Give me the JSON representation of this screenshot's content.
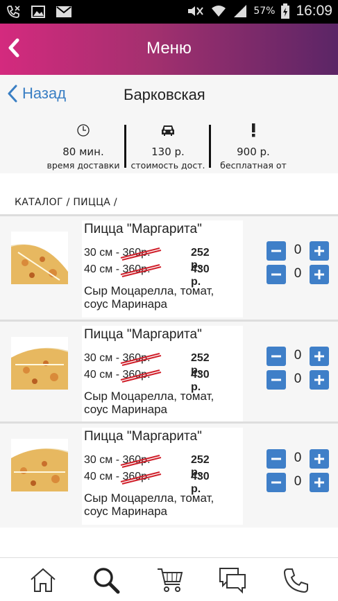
{
  "status_bar": {
    "battery": "57%",
    "time": "16:09"
  },
  "app_bar": {
    "title": "Меню"
  },
  "sub_nav": {
    "back_label": "Назад",
    "restaurant": "Барковская"
  },
  "info": [
    {
      "icon": "clock-icon",
      "value": "80 мин.",
      "label": "время доставки"
    },
    {
      "icon": "car-icon",
      "value": "130 р.",
      "label": "стоимость дост."
    },
    {
      "icon": "exclamation-icon",
      "value": "900 р.",
      "label": "бесплатная от"
    }
  ],
  "breadcrumb": "КАТАЛОГ / ПИЦЦА /",
  "items": [
    {
      "name": "Пицца \"Маргарита\"",
      "variants": [
        {
          "size": "30 см - ",
          "old_price": "360р.",
          "new_price": "252 р.",
          "qty": "0"
        },
        {
          "size": "40 см - ",
          "old_price": "360р.",
          "new_price": "430 р.",
          "qty": "0"
        }
      ],
      "description_line1": "Сыр Моцарелла, томат,",
      "description_line2": "соус Маринара"
    },
    {
      "name": "Пицца \"Маргарита\"",
      "variants": [
        {
          "size": "30 см - ",
          "old_price": "360р.",
          "new_price": "252 р.",
          "qty": "0"
        },
        {
          "size": "40 см - ",
          "old_price": "360р.",
          "new_price": "430 р.",
          "qty": "0"
        }
      ],
      "description_line1": "Сыр Моцарелла, томат,",
      "description_line2": "соус Маринара"
    },
    {
      "name": "Пицца \"Маргарита\"",
      "variants": [
        {
          "size": "30 см - ",
          "old_price": "360р.",
          "new_price": "252 р.",
          "qty": "0"
        },
        {
          "size": "40 см - ",
          "old_price": "360р.",
          "new_price": "430 р.",
          "qty": "0"
        }
      ],
      "description_line1": "Сыр Моцарелла, томат,",
      "description_line2": "соус Маринара"
    }
  ],
  "bottom_tabs": [
    "home-icon",
    "search-icon",
    "cart-icon",
    "chat-icon",
    "phone-icon"
  ],
  "colors": {
    "accent_blue": "#3f7fc8",
    "strike_red": "#d01f2a",
    "header_start": "#d42a7e",
    "header_end": "#5b2566"
  }
}
